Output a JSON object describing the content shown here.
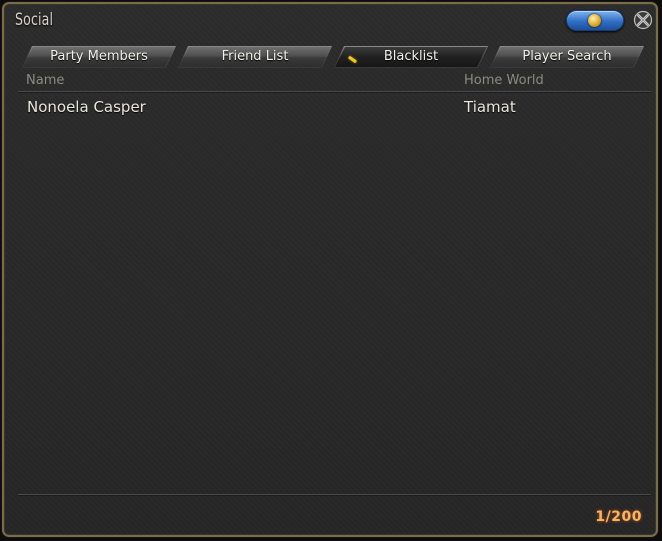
{
  "window": {
    "title": "Social"
  },
  "tabs": [
    {
      "label": "Party Members",
      "active": false
    },
    {
      "label": "Friend List",
      "active": false
    },
    {
      "label": "Blacklist",
      "active": true
    },
    {
      "label": "Player Search",
      "active": false
    }
  ],
  "table": {
    "columns": [
      "Name",
      "Home World"
    ],
    "rows": [
      {
        "name": "Nonoela Casper",
        "home_world": "Tiamat"
      }
    ]
  },
  "footer": {
    "count": "1/200"
  },
  "icons": {
    "help": "help-icon",
    "close": "close-icon"
  },
  "colors": {
    "accent_gold": "#f0c72a",
    "count_text": "#f3b56a",
    "frame_border": "#7b6b4d",
    "help_button": "#2f6fc4"
  }
}
